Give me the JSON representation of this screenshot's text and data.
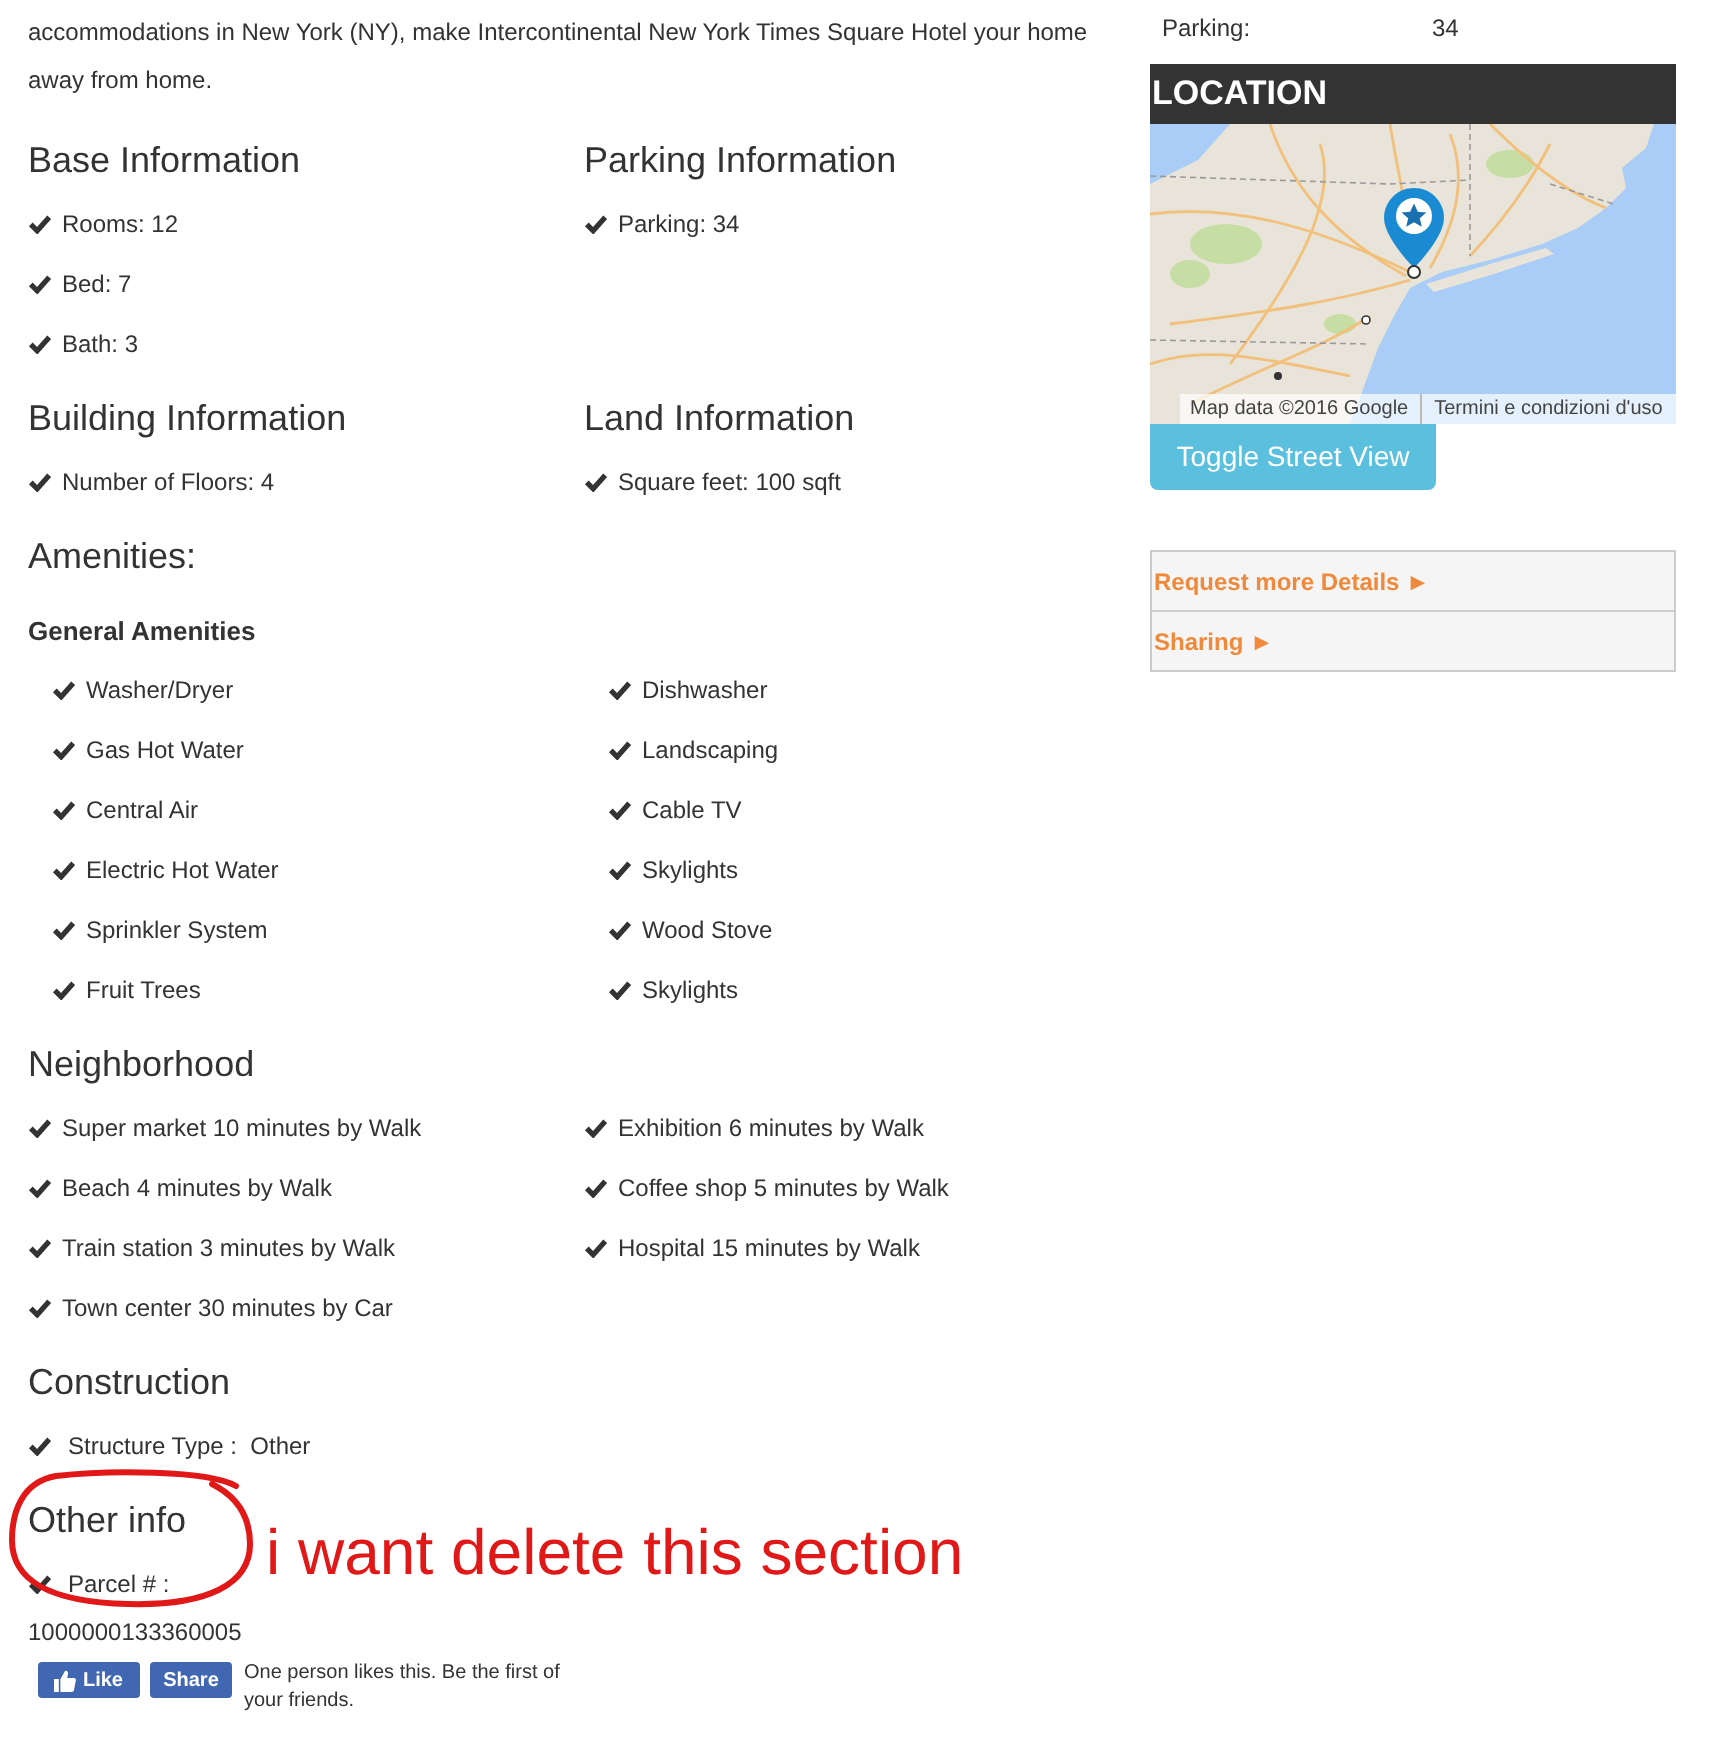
{
  "intro": "accommodations in New York (NY), make Intercontinental New York Times Square Hotel your home away from home.",
  "info_sections": [
    {
      "title": "Base Information",
      "items": [
        "Rooms: 12",
        "Bed: 7",
        "Bath: 3"
      ]
    },
    {
      "title": "Parking Information",
      "items": [
        "Parking: 34"
      ]
    },
    {
      "title": "Building Information",
      "items": [
        "Number of Floors: 4"
      ]
    },
    {
      "title": "Land Information",
      "items": [
        "Square feet: 100 sqft"
      ]
    }
  ],
  "amenities": {
    "title": "Amenities:",
    "groups": [
      {
        "title": "General Amenities",
        "items": [
          "Washer/Dryer",
          "Dishwasher",
          "Gas Hot Water",
          "Landscaping",
          "Central Air",
          "Cable TV",
          "Electric Hot Water",
          "Skylights",
          "Sprinkler System",
          "Wood Stove",
          "Fruit Trees",
          "Skylights"
        ]
      }
    ]
  },
  "neighborhood": {
    "title": "Neighborhood",
    "items": [
      "Super market 10 minutes by Walk",
      "Exhibition 6 minutes by Walk",
      "Beach 4 minutes by Walk",
      "Coffee shop 5 minutes by Walk",
      "Train station 3 minutes by Walk",
      "Hospital 15 minutes by Walk",
      "Town center 30 minutes by Car"
    ]
  },
  "construction": {
    "title": "Construction",
    "items": [
      "Structure Type :  Other"
    ]
  },
  "other_info": {
    "title": "Other info",
    "items": [
      {
        "label": "Parcel # :",
        "value": "1000000133360005"
      }
    ]
  },
  "social": {
    "buttons": [
      {
        "kind": "like",
        "label": "Like"
      },
      {
        "kind": "share",
        "label": "Share"
      }
    ],
    "text": "One person likes this. Be the first of your friends."
  },
  "annotation": {
    "text": "i want delete this section"
  },
  "sidebar": {
    "summary": [
      {
        "label": "Parking:",
        "value": "34"
      }
    ],
    "location": {
      "title": "LOCATION",
      "attribution": "Map data ©2016 Google",
      "terms_link": "Termini e condizioni d'uso",
      "street_view_button": "Toggle Street View"
    },
    "accordion": [
      "Request more Details ►",
      "Sharing ►"
    ]
  }
}
